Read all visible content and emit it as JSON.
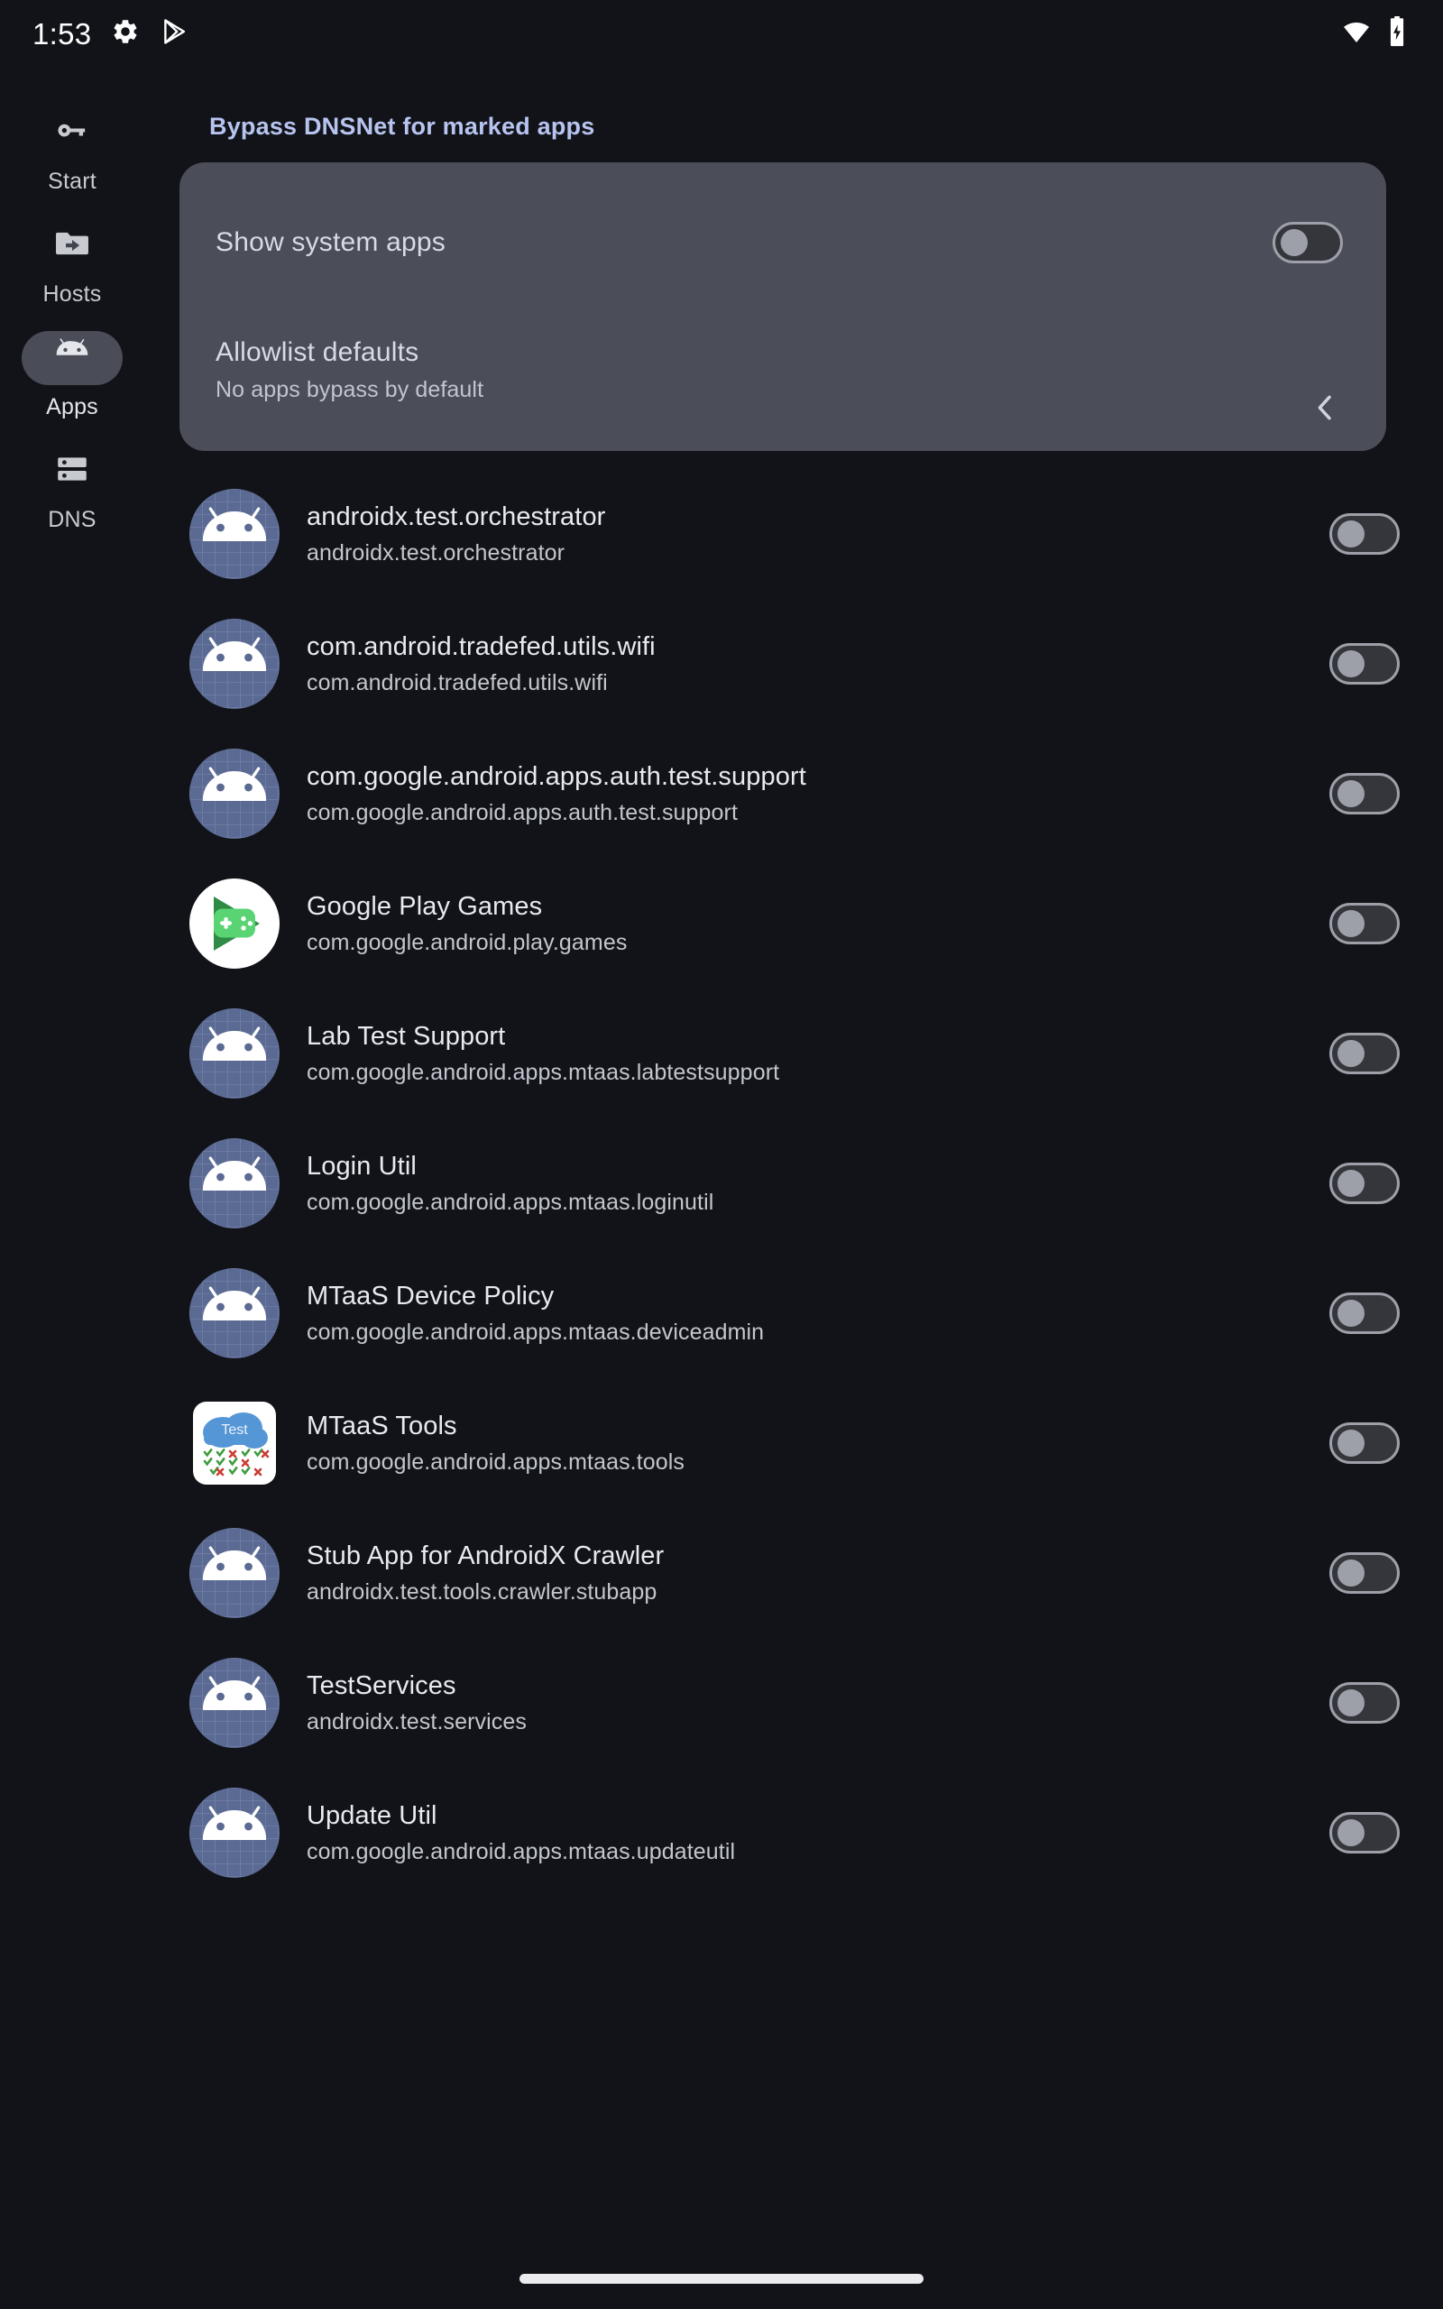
{
  "status_bar": {
    "clock": "1:53",
    "left_icons": [
      "gear-icon",
      "play-store-icon"
    ],
    "right_icons": [
      "wifi-icon",
      "battery-charging-icon"
    ]
  },
  "nav_rail": {
    "items": [
      {
        "label": "Start",
        "icon": "key-icon",
        "active": false
      },
      {
        "label": "Hosts",
        "icon": "folder-arrow-icon",
        "active": false
      },
      {
        "label": "Apps",
        "icon": "android-robot-icon",
        "active": true
      },
      {
        "label": "DNS",
        "icon": "server-icon",
        "active": false
      }
    ]
  },
  "section_header": "Bypass DNSNet for marked apps",
  "settings_card": {
    "show_system_apps": {
      "title": "Show system apps",
      "toggle_state": "off"
    },
    "allowlist_defaults": {
      "title": "Allowlist defaults",
      "subtitle": "No apps bypass by default",
      "chevron": "chevron-left-icon"
    }
  },
  "app_list": [
    {
      "name": "androidx.test.orchestrator",
      "package": "androidx.test.orchestrator",
      "icon": "android-default-icon",
      "toggle_state": "off"
    },
    {
      "name": "com.android.tradefed.utils.wifi",
      "package": "com.android.tradefed.utils.wifi",
      "icon": "android-default-icon",
      "toggle_state": "off"
    },
    {
      "name": "com.google.android.apps.auth.test.support",
      "package": "com.google.android.apps.auth.test.support",
      "icon": "android-default-icon",
      "toggle_state": "off"
    },
    {
      "name": "Google Play Games",
      "package": "com.google.android.play.games",
      "icon": "play-games-icon",
      "toggle_state": "off"
    },
    {
      "name": "Lab Test Support",
      "package": "com.google.android.apps.mtaas.labtestsupport",
      "icon": "android-default-icon",
      "toggle_state": "off"
    },
    {
      "name": "Login Util",
      "package": "com.google.android.apps.mtaas.loginutil",
      "icon": "android-default-icon",
      "toggle_state": "off"
    },
    {
      "name": "MTaaS Device Policy",
      "package": "com.google.android.apps.mtaas.deviceadmin",
      "icon": "android-default-icon",
      "toggle_state": "off"
    },
    {
      "name": "MTaaS Tools",
      "package": "com.google.android.apps.mtaas.tools",
      "icon": "mtaas-tools-icon",
      "toggle_state": "off"
    },
    {
      "name": "Stub App for AndroidX Crawler",
      "package": "androidx.test.tools.crawler.stubapp",
      "icon": "android-default-icon",
      "toggle_state": "off"
    },
    {
      "name": "TestServices",
      "package": "androidx.test.services",
      "icon": "android-default-icon",
      "toggle_state": "off"
    },
    {
      "name": "Update Util",
      "package": "com.google.android.apps.mtaas.updateutil",
      "icon": "android-default-icon",
      "toggle_state": "off"
    }
  ],
  "colors": {
    "background": "#111318",
    "card": "#4b4e58",
    "accent_header": "#b8c4f0",
    "rail_active_pill": "#4a4d57",
    "icon_default_bg": "#5b6a93"
  }
}
